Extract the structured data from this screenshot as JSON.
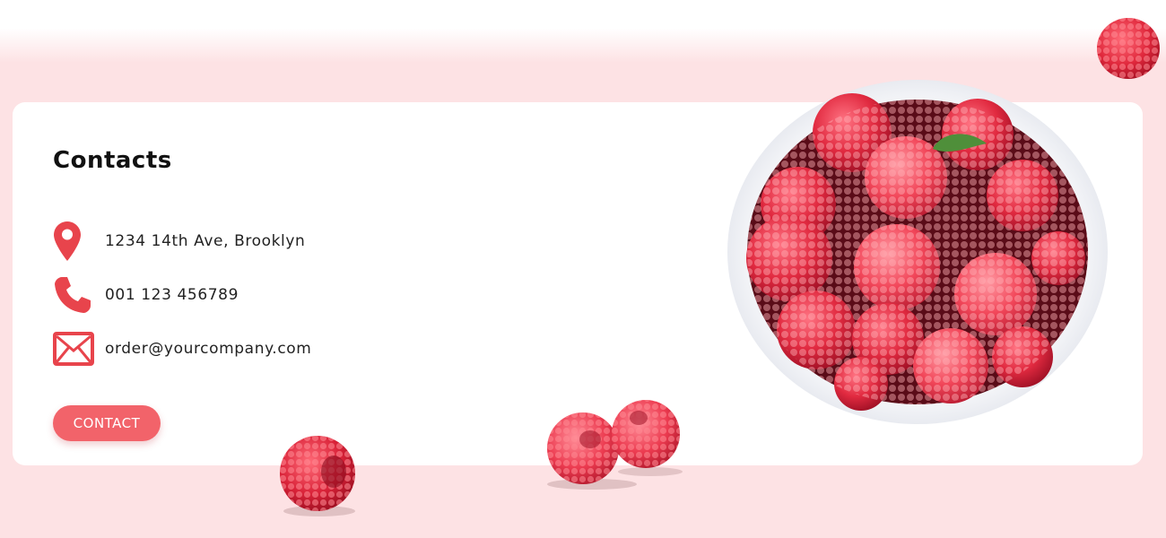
{
  "contacts": {
    "title": "Contacts",
    "address": "1234 14th Ave, Brooklyn",
    "phone": "001 123 456789",
    "email": "order@yourcompany.com",
    "button_label": "CONTACT"
  },
  "icons": {
    "address": "location-pin-icon",
    "phone": "phone-icon",
    "email": "envelope-icon"
  },
  "colors": {
    "accent": "#f2636a",
    "icon": "#e8444c",
    "background": "#fde2e4",
    "card": "#ffffff"
  }
}
